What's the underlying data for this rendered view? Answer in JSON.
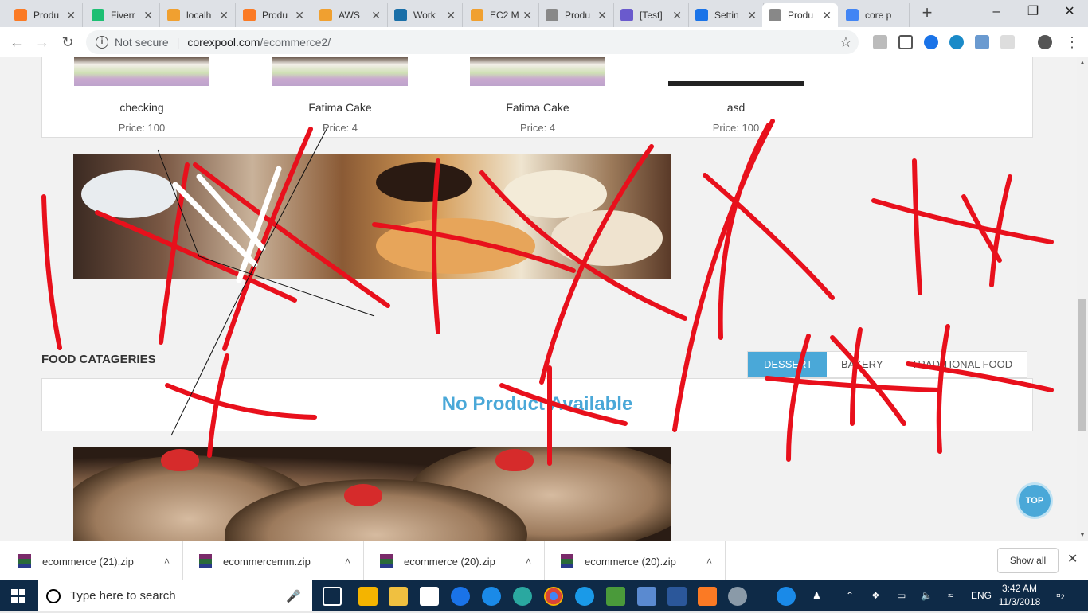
{
  "browser": {
    "tabs": [
      {
        "label": "Produ",
        "icon": "xampp-icon",
        "color": "#fb7a24"
      },
      {
        "label": "Fiverr",
        "icon": "fiverr-icon",
        "color": "#1dbf73"
      },
      {
        "label": "localh",
        "icon": "phpmyadmin-icon",
        "color": "#f0a030"
      },
      {
        "label": "Produ",
        "icon": "xampp-icon",
        "color": "#fb7a24"
      },
      {
        "label": "AWS",
        "icon": "aws-icon",
        "color": "#f0a030"
      },
      {
        "label": "Work",
        "icon": "v-icon",
        "color": "#1a6fa8"
      },
      {
        "label": "EC2 M",
        "icon": "aws-icon",
        "color": "#f0a030"
      },
      {
        "label": "Produ",
        "icon": "page-icon",
        "color": "#888888"
      },
      {
        "label": "[Test]",
        "icon": "s-icon",
        "color": "#6a5acd"
      },
      {
        "label": "Settin",
        "icon": "gear-icon",
        "color": "#1a73e8"
      },
      {
        "label": "Produ",
        "icon": "page-icon",
        "color": "#888888"
      },
      {
        "label": "core p",
        "icon": "google-icon",
        "color": "#4285f4"
      }
    ],
    "url": {
      "security": "Not secure",
      "host": "corexpool.com",
      "path": "/ecommerce2/"
    }
  },
  "products": [
    {
      "name": "checking",
      "price": "Price: 100"
    },
    {
      "name": "Fatima Cake",
      "price": "Price: 4"
    },
    {
      "name": "Fatima Cake",
      "price": "Price: 4"
    },
    {
      "name": "asd",
      "price": "Price: 100"
    }
  ],
  "categories": {
    "heading": "FOOD CATAGERIES",
    "tabs": [
      "DESSERT",
      "BAKERY",
      "TRADITIONAL FOOD"
    ],
    "active_tab": "DESSERT",
    "empty_message": "No Product Available"
  },
  "top_button": "TOP",
  "downloads": {
    "items": [
      "ecommerce (21).zip",
      "ecommercemm.zip",
      "ecommerce (20).zip",
      "ecommerce (20).zip"
    ],
    "show_all": "Show all"
  },
  "taskbar": {
    "search_placeholder": "Type here to search",
    "language": "ENG",
    "time": "3:42 AM",
    "date": "11/3/2018",
    "notifications": "2"
  },
  "colors": {
    "accent": "#4aa8d8",
    "scribble": "#e8101c"
  }
}
